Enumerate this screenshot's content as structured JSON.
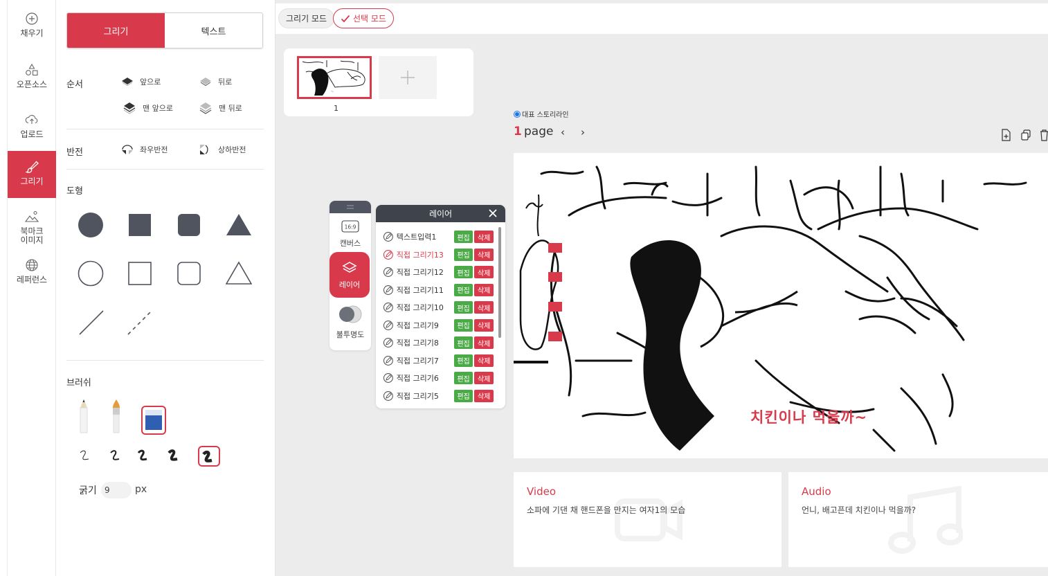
{
  "rail": {
    "items": [
      {
        "label": "채우기",
        "icon": "plus-circle-icon"
      },
      {
        "label": "오픈소스",
        "icon": "shapes-icon"
      },
      {
        "label": "업로드",
        "icon": "upload-icon"
      },
      {
        "label": "그리기",
        "icon": "brush-icon",
        "active": true
      },
      {
        "label": "북마크\n이미지",
        "icon": "bookmark-image-icon"
      },
      {
        "label": "레퍼런스",
        "icon": "globe-icon"
      }
    ]
  },
  "panel": {
    "tabs": {
      "draw": "그리기",
      "text": "텍스트"
    },
    "order": {
      "label": "순서",
      "forward": "앞으로",
      "backward": "뒤로",
      "front": "맨 앞으로",
      "back": "맨 뒤로"
    },
    "flip": {
      "label": "반전",
      "horizontal": "좌우반전",
      "vertical": "상하반전"
    },
    "shapes": {
      "label": "도형"
    },
    "brush": {
      "label": "브러쉬",
      "thickness_label": "굵기",
      "thickness_value": "9",
      "unit": "px"
    }
  },
  "topbar": {
    "draw_mode": "그리기 모드",
    "select_mode": "선택 모드"
  },
  "thumbnails": {
    "page_number": "1"
  },
  "dock": {
    "canvas_ratio": "16:9",
    "canvas": "캔버스",
    "layer": "레이어",
    "opacity": "불투명도"
  },
  "layers": {
    "title": "레이어",
    "edit_label": "편집",
    "delete_label": "삭제",
    "items": [
      {
        "name": "텍스트입력1",
        "selected": false
      },
      {
        "name": "직접 그리기13",
        "selected": true
      },
      {
        "name": "직접 그리기12",
        "selected": false
      },
      {
        "name": "직접 그리기11",
        "selected": false
      },
      {
        "name": "직접 그리기10",
        "selected": false
      },
      {
        "name": "직접 그리기9",
        "selected": false
      },
      {
        "name": "직접 그리기8",
        "selected": false
      },
      {
        "name": "직접 그리기7",
        "selected": false
      },
      {
        "name": "직접 그리기6",
        "selected": false
      },
      {
        "name": "직접 그리기5",
        "selected": false
      }
    ]
  },
  "story": {
    "radio_label": "대표 스토리라인",
    "page_number": "1",
    "page_word": "page",
    "prev": "‹",
    "next": "›",
    "canvas_caption": "치킨이나 먹을까~"
  },
  "cards": [
    {
      "title": "Video",
      "desc": "소파에 기댄 채 핸드폰을 만지는 여자1의 모습"
    },
    {
      "title": "Audio",
      "desc": "언니, 배고픈데 치킨이나 먹을까?"
    }
  ],
  "colors": {
    "accent": "#d93a4b",
    "edit_green": "#4aaa46",
    "panel_dark": "#3f434c",
    "radio_blue": "#1e73e8"
  }
}
